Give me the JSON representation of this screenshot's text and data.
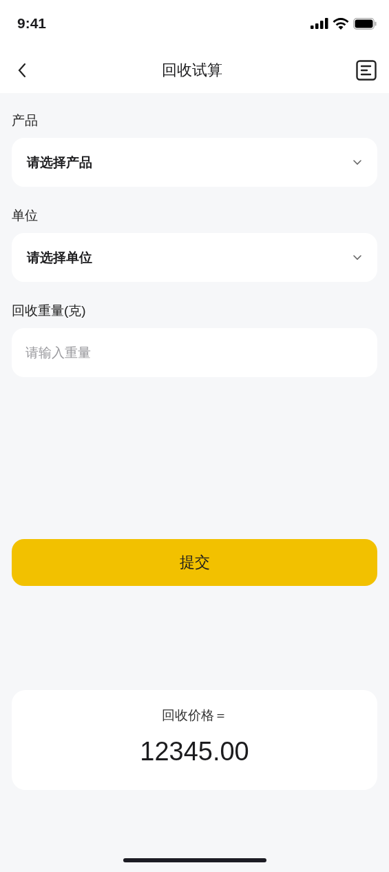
{
  "status_bar": {
    "time": "9:41"
  },
  "nav": {
    "title": "回收试算"
  },
  "fields": [
    {
      "kind": "select",
      "label": "产品",
      "value": "请选择产品"
    },
    {
      "kind": "select",
      "label": "单位",
      "value": "请选择单位"
    },
    {
      "kind": "input",
      "label": "回收重量(克)",
      "placeholder": "请输入重量"
    }
  ],
  "submit_button": "提交",
  "result": {
    "label": "回收价格＝",
    "value": "12345.00"
  }
}
